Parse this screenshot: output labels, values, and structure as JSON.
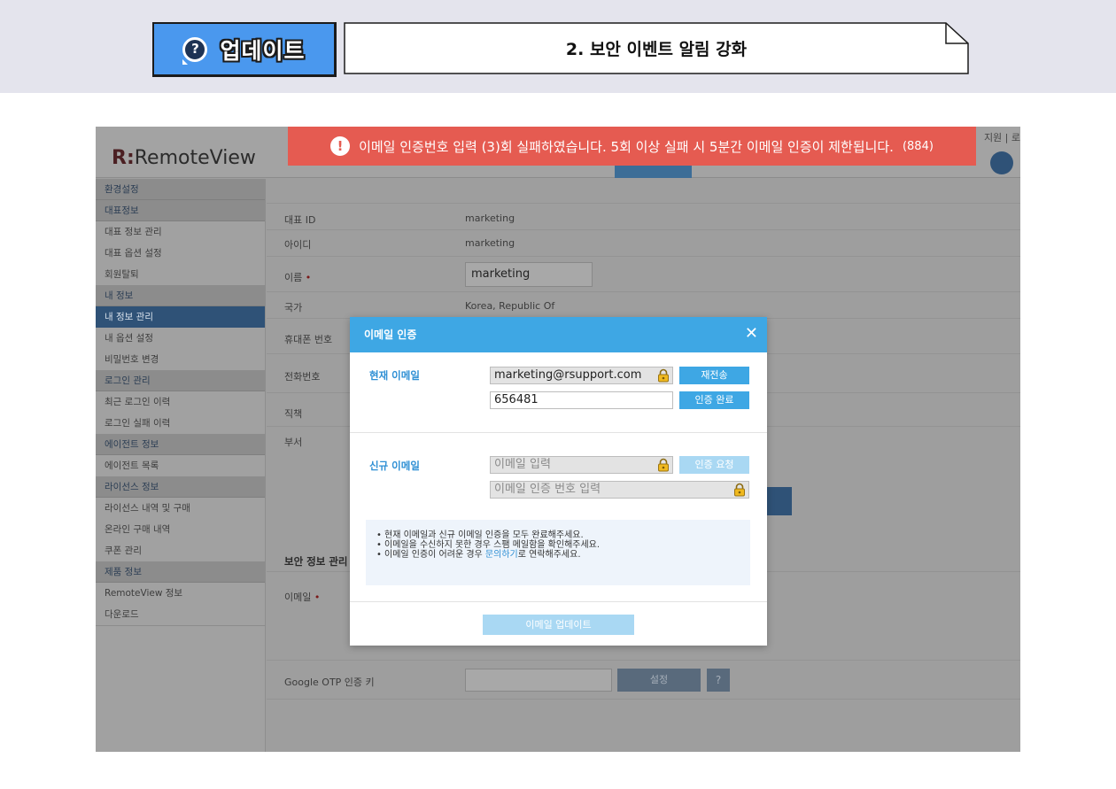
{
  "banner": {
    "badge_icon": "?",
    "badge_label": "업데이트",
    "title": "2. 보안 이벤트 알림 강화"
  },
  "alert": {
    "icon": "!",
    "message": "이메일 인증번호 입력 (3)회 실패하였습니다. 5회 이상 실패 시 5분간 이메일 인증이 제한됩니다.",
    "code": "(884)",
    "color": "#e55b51"
  },
  "header": {
    "logo_mark": "R:",
    "logo_text": "RemoteView",
    "links": "지원 | 로"
  },
  "sidebar": {
    "items": [
      {
        "label": "환경설정",
        "type": "head"
      },
      {
        "label": "대표정보",
        "type": "head"
      },
      {
        "label": "대표 정보 관리",
        "type": "item"
      },
      {
        "label": "대표 옵션 설정",
        "type": "item"
      },
      {
        "label": "회원탈퇴",
        "type": "item"
      },
      {
        "label": "내 정보",
        "type": "head"
      },
      {
        "label": "내 정보 관리",
        "type": "sel"
      },
      {
        "label": "내 옵션 설정",
        "type": "item"
      },
      {
        "label": "비밀번호 변경",
        "type": "item"
      },
      {
        "label": "로그인 관리",
        "type": "head"
      },
      {
        "label": "최근 로그인 이력",
        "type": "item"
      },
      {
        "label": "로그인 실패 이력",
        "type": "item"
      },
      {
        "label": "에이전트 정보",
        "type": "head"
      },
      {
        "label": "에이전트 목록",
        "type": "item"
      },
      {
        "label": "라이선스 정보",
        "type": "head"
      },
      {
        "label": "라이선스 내역 및 구매",
        "type": "item"
      },
      {
        "label": "온라인 구매 내역",
        "type": "item"
      },
      {
        "label": "쿠폰 관리",
        "type": "item"
      },
      {
        "label": "제품 정보",
        "type": "head"
      },
      {
        "label": "RemoteView 정보",
        "type": "item"
      },
      {
        "label": "다운로드",
        "type": "item"
      }
    ]
  },
  "form": {
    "rep_id_label": "대표 ID",
    "rep_id_value": "marketing",
    "id_label": "아이디",
    "id_value": "marketing",
    "name_label": "이름",
    "required_mark": "•",
    "name_value": "marketing",
    "country_label": "국가",
    "country_value": "Korea, Republic Of",
    "mobile_label": "휴대폰 번호",
    "phone_label": "전화번호",
    "position_label": "직책",
    "dept_label": "부서",
    "security_title": "보안 정보 관리",
    "email_label": "이메일",
    "otp_label": "Google OTP 인증 키",
    "otp_button": "설정",
    "otp_help": "?"
  },
  "modal": {
    "title": "이메일 인증",
    "close": "✕",
    "current_label": "현재 이메일",
    "current_email": "marketing@rsupport.com",
    "resend_button": "재전송",
    "code_value": "656481",
    "verify_button": "인증 완료",
    "new_label": "신규 이메일",
    "new_email_placeholder": "이메일 입력",
    "request_button": "인증 요청",
    "new_code_placeholder": "이메일 인증 번호 입력",
    "notes": {
      "line1": "현재 이메일과 신규 이메일 인증을 모두 완료해주세요.",
      "line2": "이메일을 수신하지 못한 경우 스팸 메일함을 확인해주세요.",
      "line3_pre": "이메일 인증이 어려운 경우 ",
      "line3_link": "문의하기",
      "line3_post": "로 연락해주세요."
    },
    "update_button": "이메일 업데이트"
  }
}
